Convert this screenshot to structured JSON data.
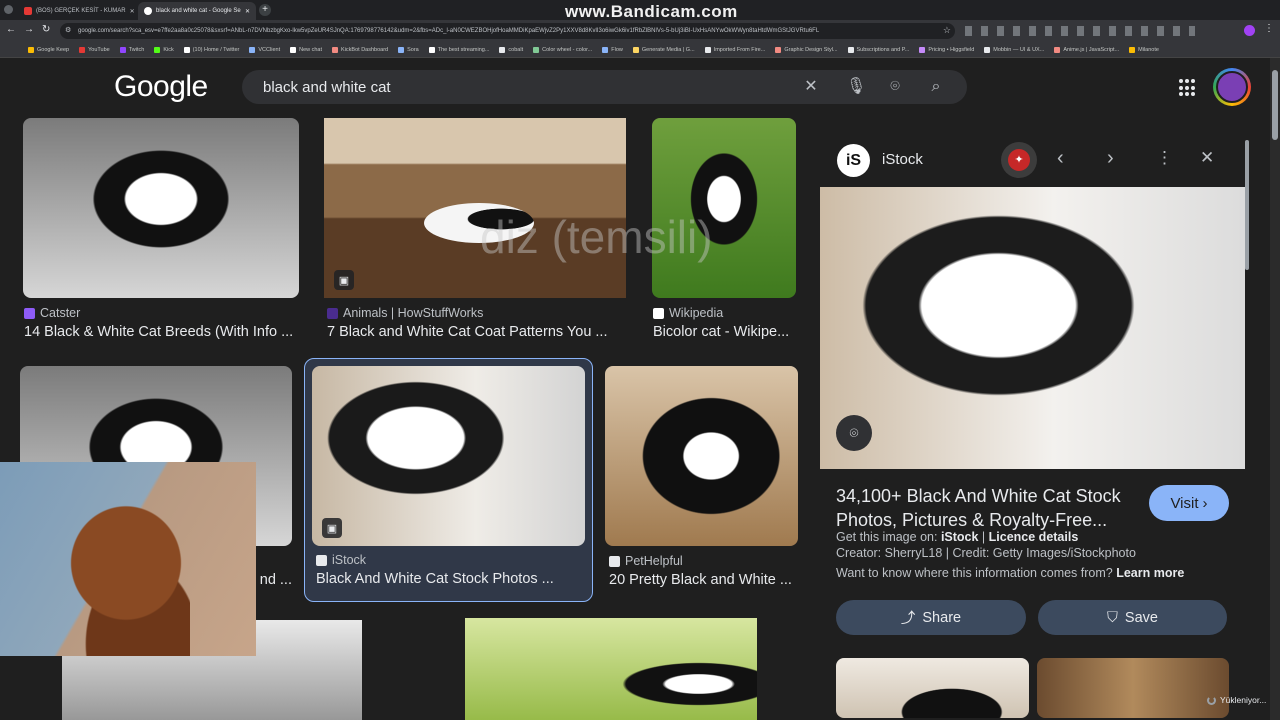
{
  "browser": {
    "tabs": [
      {
        "label": "(BOS) GERÇEK KESİT - KUMAR",
        "active": false
      },
      {
        "label": "black and white cat - Google Se",
        "active": true
      }
    ],
    "url": "google.com/search?sca_esv=e7ffe2aa8a0c25078&sxsrf=ANbL-n7DVNbzbgKxo-lkw5vpZeUR4SJnQA:1769798776142&udm=2&fbs=ADc_l-aN0CWEZBOHjofHoaMMDiKpaEWjvZ2Py1XXV8d8KvlI3o6iwGk6iv1fRbZlBNlVs-5-bUj3iBI-UxHsANYwOkWWyn8taHtdWmGStJGVRtu6FL",
    "bookmarks": [
      "Google Keep",
      "YouTube",
      "Twitch",
      "Kick",
      "(10) Home / Twitter",
      "VCClient",
      "New chat",
      "KickBot Dashboard",
      "Sora",
      "The best streaming...",
      "cobalt",
      "Color wheel - color...",
      "Flow",
      "Generate Media | G...",
      "Imported From Fire...",
      "Graphic Design Styl...",
      "Subscriptions and P...",
      "Pricing • Higgsfield",
      "Mobbin — UI & UX...",
      "Anime.js | JavaScript...",
      "Milanote"
    ],
    "watermark": "www.Bandicam.com"
  },
  "header": {
    "logo": "Google",
    "query": "black and white cat"
  },
  "results": [
    {
      "source": "Catster",
      "title": "14 Black & White Cat Breeds (With Info ..."
    },
    {
      "source": "Animals | HowStuffWorks",
      "title": "7 Black and White Cat Coat Patterns You ..."
    },
    {
      "source": "Wikipedia",
      "title": "Bicolor cat - Wikipe..."
    },
    {
      "source": "",
      "title": "nd ..."
    },
    {
      "source": "iStock",
      "title": "Black And White Cat Stock Photos ..."
    },
    {
      "source": "PetHelpful",
      "title": "20 Pretty Black and White ..."
    }
  ],
  "overlay_text": "diz (temsili)",
  "panel": {
    "site": "iStock",
    "title": "34,100+ Black And White Cat Stock Photos, Pictures & Royalty-Free...",
    "visit_label": "Visit",
    "get_image_on": "Get this image on:",
    "get_image_site": "iStock",
    "licence": "Licence details",
    "credit": "Creator: SherryL18 | Credit: Getty Images/iStockphoto",
    "question": "Want to know where this information comes from?",
    "learn_more": "Learn more",
    "share_label": "Share",
    "save_label": "Save"
  },
  "status": {
    "loading": "Yükleniyor..."
  },
  "colors": {
    "accent": "#8ab4f8",
    "page_bg": "#1f1f1f",
    "search_bg": "#303134"
  }
}
